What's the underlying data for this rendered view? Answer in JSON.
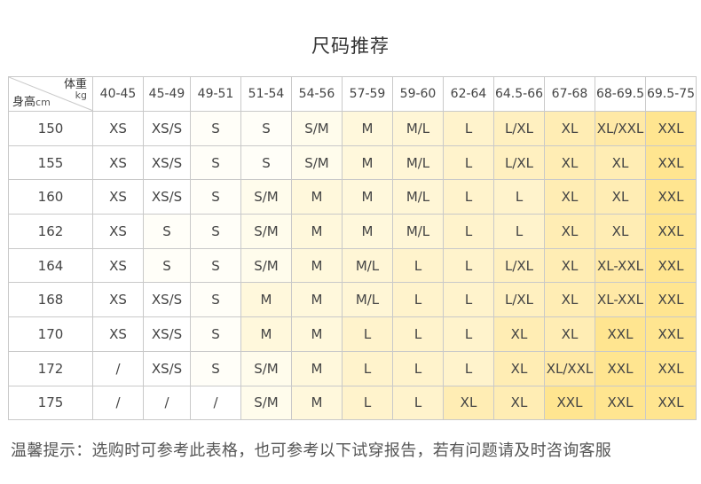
{
  "title": "尺码推荐",
  "corner": {
    "weight_label": "体重",
    "weight_unit": "kg",
    "height_label": "身高",
    "height_unit": "cm"
  },
  "weights": [
    "40-45",
    "45-49",
    "49-51",
    "51-54",
    "54-56",
    "57-59",
    "59-60",
    "62-64",
    "64.5-66",
    "67-68",
    "68-69.5",
    "69.5-75"
  ],
  "rows": [
    {
      "height": "150",
      "sizes": [
        "XS",
        "XS/S",
        "S",
        "S",
        "S/M",
        "M",
        "M/L",
        "L",
        "L/XL",
        "XL",
        "XL/XXL",
        "XXL"
      ]
    },
    {
      "height": "155",
      "sizes": [
        "XS",
        "XS/S",
        "S",
        "S",
        "S/M",
        "M",
        "M/L",
        "L",
        "L/XL",
        "XL",
        "XL",
        "XXL"
      ]
    },
    {
      "height": "160",
      "sizes": [
        "XS",
        "XS/S",
        "S",
        "S/M",
        "M",
        "M",
        "M/L",
        "L",
        "L",
        "XL",
        "XL",
        "XXL"
      ]
    },
    {
      "height": "162",
      "sizes": [
        "XS",
        "S",
        "S",
        "S/M",
        "M",
        "M",
        "M/L",
        "L",
        "L",
        "XL",
        "XL",
        "XXL"
      ]
    },
    {
      "height": "164",
      "sizes": [
        "XS",
        "S",
        "S",
        "S/M",
        "M",
        "M/L",
        "L",
        "L",
        "L/XL",
        "XL",
        "XL-XXL",
        "XXL"
      ]
    },
    {
      "height": "168",
      "sizes": [
        "XS",
        "XS/S",
        "S",
        "M",
        "M",
        "M/L",
        "L",
        "L",
        "L/XL",
        "XL",
        "XL-XXL",
        "XXL"
      ]
    },
    {
      "height": "170",
      "sizes": [
        "XS",
        "XS/S",
        "S",
        "M",
        "M",
        "L",
        "L",
        "L",
        "XL",
        "XL",
        "XXL",
        "XXL"
      ]
    },
    {
      "height": "172",
      "sizes": [
        "/",
        "XS/S",
        "S",
        "S/M",
        "M",
        "L",
        "L",
        "L",
        "XL",
        "XL/XXL",
        "XXL",
        "XXL"
      ]
    },
    {
      "height": "175",
      "sizes": [
        "/",
        "/",
        "/",
        "S/M",
        "M",
        "L",
        "L",
        "XL",
        "XL",
        "XXL",
        "XXL",
        "XXL"
      ]
    }
  ],
  "size_colors": {
    "/": "#ffffff",
    "XS": "#ffffff",
    "XS/S": "#ffffff",
    "S": "#fffef8",
    "S/M": "#fffcec",
    "M": "#fff8dc",
    "M/L": "#fff6d6",
    "L": "#fff3cc",
    "L/XL": "#fff0c0",
    "XL": "#ffedb4",
    "XL/XXL": "#ffe9a6",
    "XL-XXL": "#ffe9a6",
    "XXL": "#ffe590"
  },
  "note": "温馨提示：选购时可参考此表格，也可参考以下试穿报告，若有问题请及时咨询客服"
}
